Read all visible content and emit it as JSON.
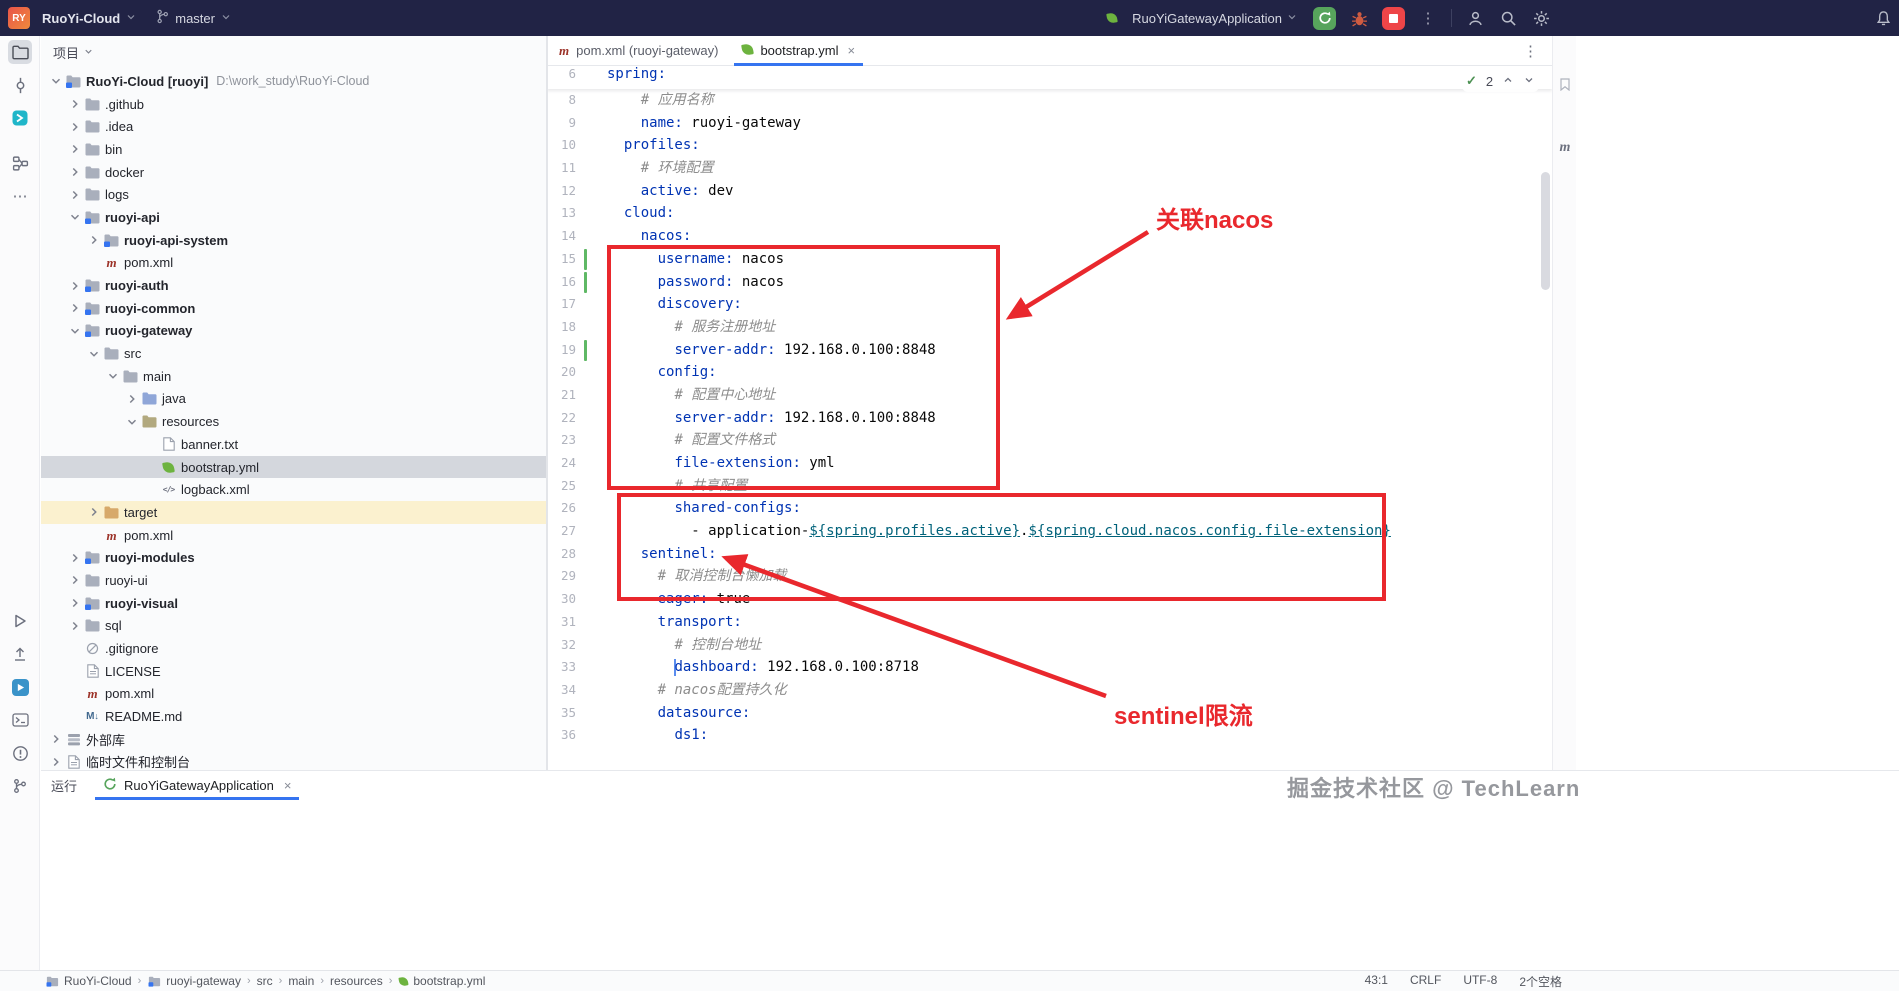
{
  "title_bar": {
    "logo": "RY",
    "project_button": "RuoYi-Cloud",
    "branch_button": "master",
    "run_config": "RuoYiGatewayApplication"
  },
  "project_panel": {
    "title": "项目",
    "tree": [
      {
        "l": "RuoYi-Cloud [ruoyi]",
        "extra": "D:\\work_study\\RuoYi-Cloud",
        "lv": 0,
        "ic": "project",
        "ch": "e",
        "b": 1
      },
      {
        "l": ".github",
        "lv": 1,
        "ic": "folder",
        "ch": "c"
      },
      {
        "l": ".idea",
        "lv": 1,
        "ic": "folder",
        "ch": "c"
      },
      {
        "l": "bin",
        "lv": 1,
        "ic": "folder",
        "ch": "c"
      },
      {
        "l": "docker",
        "lv": 1,
        "ic": "folder",
        "ch": "c"
      },
      {
        "l": "logs",
        "lv": 1,
        "ic": "folder",
        "ch": "c"
      },
      {
        "l": "ruoyi-api",
        "lv": 1,
        "ic": "module",
        "ch": "e",
        "b": 1
      },
      {
        "l": "ruoyi-api-system",
        "lv": 2,
        "ic": "module",
        "ch": "c",
        "b": 1
      },
      {
        "l": "pom.xml",
        "lv": 2,
        "ic": "maven"
      },
      {
        "l": "ruoyi-auth",
        "lv": 1,
        "ic": "module",
        "ch": "c",
        "b": 1
      },
      {
        "l": "ruoyi-common",
        "lv": 1,
        "ic": "module",
        "ch": "c",
        "b": 1
      },
      {
        "l": "ruoyi-gateway",
        "lv": 1,
        "ic": "module",
        "ch": "e",
        "b": 1
      },
      {
        "l": "src",
        "lv": 2,
        "ic": "folder",
        "ch": "e"
      },
      {
        "l": "main",
        "lv": 3,
        "ic": "folder",
        "ch": "e"
      },
      {
        "l": "java",
        "lv": 4,
        "ic": "srcfolder",
        "ch": "c"
      },
      {
        "l": "resources",
        "lv": 4,
        "ic": "resfolder",
        "ch": "e"
      },
      {
        "l": "banner.txt",
        "lv": 5,
        "ic": "text"
      },
      {
        "l": "bootstrap.yml",
        "lv": 5,
        "ic": "spring",
        "sel": 1
      },
      {
        "l": "logback.xml",
        "lv": 5,
        "ic": "xml"
      },
      {
        "l": "target",
        "lv": 2,
        "ic": "excluded",
        "ch": "c",
        "hl": 1
      },
      {
        "l": "pom.xml",
        "lv": 2,
        "ic": "maven"
      },
      {
        "l": "ruoyi-modules",
        "lv": 1,
        "ic": "module",
        "ch": "c",
        "b": 1
      },
      {
        "l": "ruoyi-ui",
        "lv": 1,
        "ic": "folder",
        "ch": "c"
      },
      {
        "l": "ruoyi-visual",
        "lv": 1,
        "ic": "module",
        "ch": "c",
        "b": 1
      },
      {
        "l": "sql",
        "lv": 1,
        "ic": "folder",
        "ch": "c"
      },
      {
        "l": ".gitignore",
        "lv": 1,
        "ic": "ignore"
      },
      {
        "l": "LICENSE",
        "lv": 1,
        "ic": "license"
      },
      {
        "l": "pom.xml",
        "lv": 1,
        "ic": "maven"
      },
      {
        "l": "README.md",
        "lv": 1,
        "ic": "markdown"
      },
      {
        "l": "外部库",
        "lv": 0,
        "ic": "lib",
        "ch": "c"
      },
      {
        "l": "临时文件和控制台",
        "lv": 0,
        "ic": "scratch",
        "ch": "c"
      }
    ]
  },
  "editor": {
    "tabs": [
      {
        "label": "pom.xml (ruoyi-gateway)",
        "icon": "maven",
        "active": false,
        "close": false
      },
      {
        "label": "bootstrap.yml",
        "icon": "spring",
        "active": true,
        "close": true
      }
    ],
    "tabs_more": "⋮",
    "close_glyph": "×",
    "inspection": {
      "count": "2"
    },
    "sticky_line": {
      "n": "6",
      "i": 0,
      "t": [
        [
          "key",
          "spring:"
        ]
      ]
    },
    "gutter_marks": {
      "green": [
        15,
        16,
        19
      ]
    },
    "caret_line": 33,
    "lines": [
      {
        "n": 8,
        "i": 4,
        "t": [
          [
            "com",
            "# 应用名称"
          ]
        ]
      },
      {
        "n": 9,
        "i": 4,
        "t": [
          [
            "key",
            "name:"
          ],
          [
            "val",
            " ruoyi-gateway"
          ]
        ]
      },
      {
        "n": 10,
        "i": 2,
        "t": [
          [
            "key",
            "profiles:"
          ]
        ]
      },
      {
        "n": 11,
        "i": 4,
        "t": [
          [
            "com",
            "# 环境配置"
          ]
        ]
      },
      {
        "n": 12,
        "i": 4,
        "t": [
          [
            "key",
            "active:"
          ],
          [
            "val",
            " dev"
          ]
        ]
      },
      {
        "n": 13,
        "i": 2,
        "t": [
          [
            "key",
            "cloud:"
          ]
        ]
      },
      {
        "n": 14,
        "i": 4,
        "t": [
          [
            "key",
            "nacos:"
          ]
        ]
      },
      {
        "n": 15,
        "i": 6,
        "t": [
          [
            "key",
            "username:"
          ],
          [
            "val",
            " nacos"
          ]
        ]
      },
      {
        "n": 16,
        "i": 6,
        "t": [
          [
            "key",
            "password:"
          ],
          [
            "val",
            " nacos"
          ]
        ]
      },
      {
        "n": 17,
        "i": 6,
        "t": [
          [
            "key",
            "discovery:"
          ]
        ]
      },
      {
        "n": 18,
        "i": 8,
        "t": [
          [
            "com",
            "# 服务注册地址"
          ]
        ]
      },
      {
        "n": 19,
        "i": 8,
        "t": [
          [
            "key",
            "server-addr:"
          ],
          [
            "val",
            " 192.168.0.100:8848"
          ]
        ]
      },
      {
        "n": 20,
        "i": 6,
        "t": [
          [
            "key",
            "config:"
          ]
        ]
      },
      {
        "n": 21,
        "i": 8,
        "t": [
          [
            "com",
            "# 配置中心地址"
          ]
        ]
      },
      {
        "n": 22,
        "i": 8,
        "t": [
          [
            "key",
            "server-addr:"
          ],
          [
            "val",
            " 192.168.0.100:8848"
          ]
        ]
      },
      {
        "n": 23,
        "i": 8,
        "t": [
          [
            "com",
            "# 配置文件格式"
          ]
        ]
      },
      {
        "n": 24,
        "i": 8,
        "t": [
          [
            "key",
            "file-extension:"
          ],
          [
            "val",
            " yml"
          ]
        ]
      },
      {
        "n": 25,
        "i": 8,
        "t": [
          [
            "com",
            "# 共享配置"
          ]
        ]
      },
      {
        "n": 26,
        "i": 8,
        "t": [
          [
            "key",
            "shared-configs:"
          ]
        ]
      },
      {
        "n": 27,
        "i": 10,
        "t": [
          [
            "plain",
            "- application-"
          ],
          [
            "link",
            "${spring.profiles.active}"
          ],
          [
            "plain",
            "."
          ],
          [
            "link",
            "${spring.cloud.nacos.config.file-extension}"
          ]
        ]
      },
      {
        "n": 28,
        "i": 4,
        "t": [
          [
            "key",
            "sentinel:"
          ]
        ]
      },
      {
        "n": 29,
        "i": 6,
        "t": [
          [
            "com",
            "# 取消控制台懒加载"
          ]
        ]
      },
      {
        "n": 30,
        "i": 6,
        "t": [
          [
            "key",
            "eager:"
          ],
          [
            "val",
            " true"
          ]
        ]
      },
      {
        "n": 31,
        "i": 6,
        "t": [
          [
            "key",
            "transport:"
          ]
        ]
      },
      {
        "n": 32,
        "i": 8,
        "t": [
          [
            "com",
            "# 控制台地址"
          ]
        ]
      },
      {
        "n": 33,
        "i": 8,
        "t": [
          [
            "key",
            "dashboard:"
          ],
          [
            "val",
            " 192.168.0.100:8718"
          ]
        ]
      },
      {
        "n": 34,
        "i": 6,
        "t": [
          [
            "com",
            "# nacos配置持久化"
          ]
        ]
      },
      {
        "n": 35,
        "i": 6,
        "t": [
          [
            "key",
            "datasource:"
          ]
        ]
      },
      {
        "n": 36,
        "i": 8,
        "t": [
          [
            "key",
            "ds1:"
          ]
        ]
      }
    ]
  },
  "annotations": {
    "label_nacos": "关联nacos",
    "label_sentinel": "sentinel限流",
    "color": "#e9282d"
  },
  "run_panel": {
    "title": "运行",
    "tab": "RuoYiGatewayApplication",
    "close_glyph": "×"
  },
  "status_bar": {
    "breadcrumbs": [
      {
        "label": "RuoYi-Cloud",
        "icon": "project"
      },
      {
        "label": "ruoyi-gateway",
        "icon": "module"
      },
      {
        "label": "src"
      },
      {
        "label": "main"
      },
      {
        "label": "resources"
      },
      {
        "label": "bootstrap.yml",
        "icon": "spring"
      }
    ],
    "right_items": [
      "43:1",
      "CRLF",
      "UTF-8",
      "2个空格"
    ]
  },
  "watermark": "掘金技术社区 @ TechLearn"
}
